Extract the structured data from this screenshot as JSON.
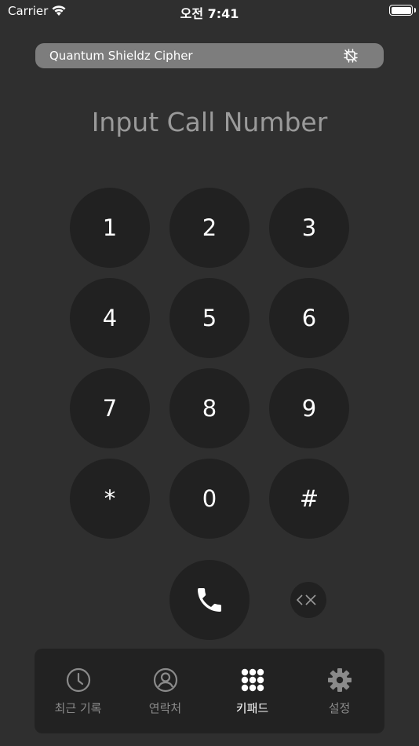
{
  "status_bar": {
    "carrier": "Carrier",
    "time": "오전 7:41",
    "battery_level": 1.0
  },
  "cipher_bar": {
    "label": "Quantum Shieldz Cipher",
    "icon": "chip-icon",
    "background_color": "#7d7d7d"
  },
  "title": "Input Call Number",
  "keypad": {
    "keys": [
      "1",
      "2",
      "3",
      "4",
      "5",
      "6",
      "7",
      "8",
      "9",
      "*",
      "0",
      "#"
    ]
  },
  "actions": {
    "call_icon": "phone-icon",
    "delete_icon": "delete-icon"
  },
  "tab_bar": {
    "active_color": "#ffffff",
    "inactive_color": "#8a8a8a",
    "tabs": [
      {
        "label": "최근 기록",
        "icon": "clock-icon",
        "active": false
      },
      {
        "label": "연락처",
        "icon": "person-icon",
        "active": false
      },
      {
        "label": "키패드",
        "icon": "keypad-icon",
        "active": true
      },
      {
        "label": "설정",
        "icon": "gear-icon",
        "active": false
      }
    ]
  }
}
